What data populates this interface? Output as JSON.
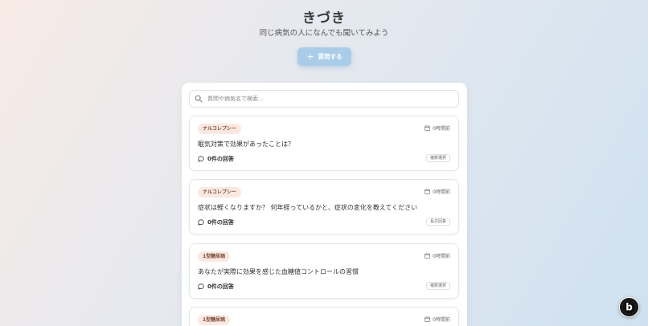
{
  "app": {
    "title": "きづき",
    "subtitle": "同じ病気の人になんでも聞いてみよう",
    "ask_button": "質問する"
  },
  "search": {
    "placeholder": "質問や病気名で検索..."
  },
  "questions": [
    {
      "tag": "ナルコレプシー",
      "time": "0時間前",
      "title": "眠気対策で効果があったことは？",
      "answers": "0件の回答",
      "type": "複数選択"
    },
    {
      "tag": "ナルコレプシー",
      "time": "0時間前",
      "title": "症状は軽くなりますか？ 何年経っているかと、症状の変化を教えてください",
      "answers": "0件の回答",
      "type": "長文回答"
    },
    {
      "tag": "1型糖尿病",
      "time": "0時間前",
      "title": "あなたが実際に効果を感じた血糖値コントロールの習慣",
      "answers": "0件の回答",
      "type": "複数選択"
    },
    {
      "tag": "1型糖尿病",
      "time": "0時間前"
    }
  ],
  "fab": {
    "icon": "b-logo-icon",
    "letter": "b"
  },
  "colors": {
    "accent": "#a9cde8",
    "tag_bg": "#fbe9e1"
  }
}
